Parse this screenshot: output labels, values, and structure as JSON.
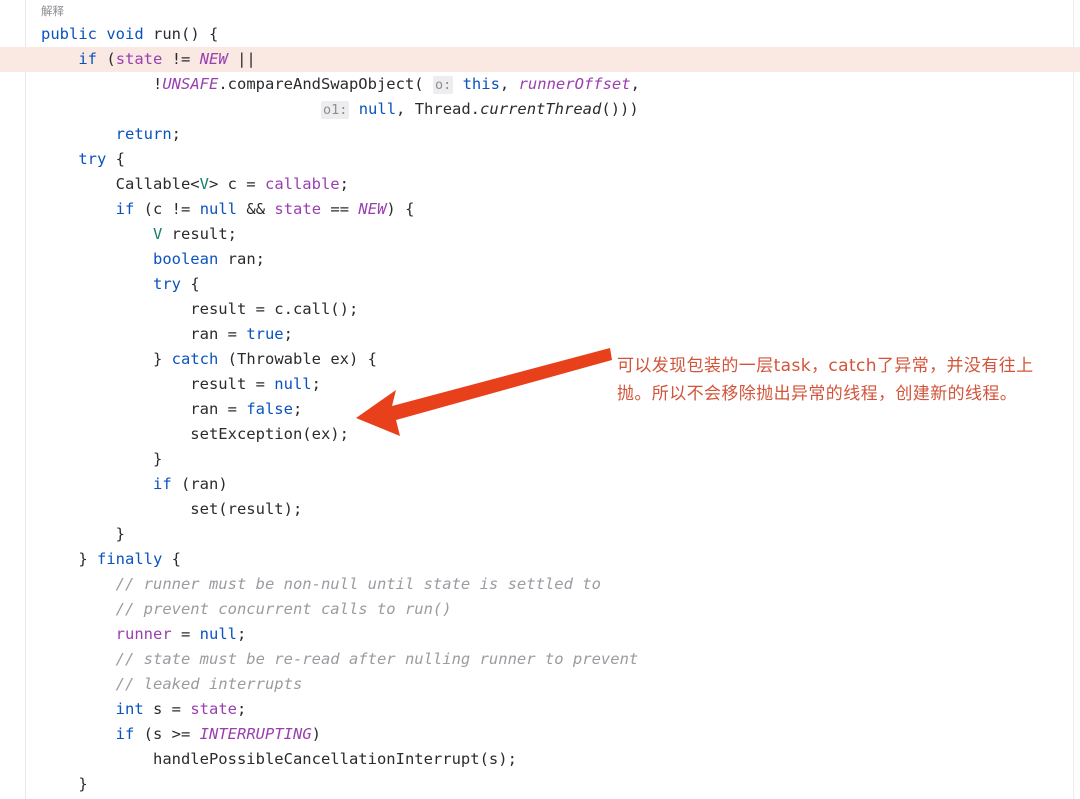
{
  "header": {
    "explain_label": "解释"
  },
  "editor": {
    "highlighted_line_index": 1,
    "colors": {
      "background": "#ffffff",
      "highlight_line": "#fae8e3",
      "keyword": "#0a53bf",
      "field": "#9a3fb0",
      "constant": "#9a3fb0",
      "comment": "#9b9ba1",
      "type_param": "#1a7f6e",
      "plain_text": "#2b2b2f",
      "param_hint_bg": "#ededf0",
      "param_hint_fg": "#8e8e93",
      "annotation_red": "#d2543a",
      "arrow_red": "#e8401a"
    },
    "lines": [
      {
        "id": "l1",
        "text": "public void run() {"
      },
      {
        "id": "l2",
        "text": "    if (state != NEW ||"
      },
      {
        "id": "l3",
        "text": "            !UNSAFE.compareAndSwapObject( o: this, runnerOffset,"
      },
      {
        "id": "l4",
        "text": "                              o1: null, Thread.currentThread()))"
      },
      {
        "id": "l5",
        "text": "        return;"
      },
      {
        "id": "l6",
        "text": "    try {"
      },
      {
        "id": "l7",
        "text": "        Callable<V> c = callable;"
      },
      {
        "id": "l8",
        "text": "        if (c != null && state == NEW) {"
      },
      {
        "id": "l9",
        "text": "            V result;"
      },
      {
        "id": "l10",
        "text": "            boolean ran;"
      },
      {
        "id": "l11",
        "text": "            try {"
      },
      {
        "id": "l12",
        "text": "                result = c.call();"
      },
      {
        "id": "l13",
        "text": "                ran = true;"
      },
      {
        "id": "l14",
        "text": "            } catch (Throwable ex) {"
      },
      {
        "id": "l15",
        "text": "                result = null;"
      },
      {
        "id": "l16",
        "text": "                ran = false;"
      },
      {
        "id": "l17",
        "text": "                setException(ex);"
      },
      {
        "id": "l18",
        "text": "            }"
      },
      {
        "id": "l19",
        "text": "            if (ran)"
      },
      {
        "id": "l20",
        "text": "                set(result);"
      },
      {
        "id": "l21",
        "text": "        }"
      },
      {
        "id": "l22",
        "text": "    } finally {"
      },
      {
        "id": "l23",
        "text": "        // runner must be non-null until state is settled to"
      },
      {
        "id": "l24",
        "text": "        // prevent concurrent calls to run()"
      },
      {
        "id": "l25",
        "text": "        runner = null;"
      },
      {
        "id": "l26",
        "text": "        // state must be re-read after nulling runner to prevent"
      },
      {
        "id": "l27",
        "text": "        // leaked interrupts"
      },
      {
        "id": "l28",
        "text": "        int s = state;"
      },
      {
        "id": "l29",
        "text": "        if (s >= INTERRUPTING)"
      },
      {
        "id": "l30",
        "text": "            handlePossibleCancellationInterrupt(s);"
      },
      {
        "id": "l31",
        "text": "    }"
      }
    ],
    "param_hints": [
      "o:",
      "o1:"
    ]
  },
  "annotation": {
    "text": "可以发现包装的一层task，catch了异常，并没有往上抛。所以不会移除抛出异常的线程，创建新的线程。",
    "arrow_target_line": "setException(ex);"
  }
}
